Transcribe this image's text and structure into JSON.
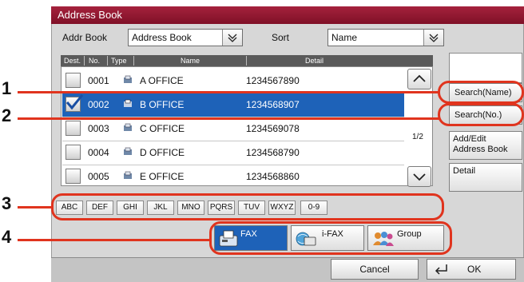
{
  "window": {
    "title": "Address Book"
  },
  "top": {
    "addr_book_label": "Addr Book",
    "addr_book_value": "Address Book",
    "sort_label": "Sort",
    "sort_value": "Name"
  },
  "table": {
    "headers": [
      "Dest.",
      "No.",
      "Type",
      "Name",
      "Detail"
    ],
    "rows": [
      {
        "checked": false,
        "no": "0001",
        "type_icon": "fax-icon",
        "name": "A OFFICE",
        "detail": "1234567890"
      },
      {
        "checked": true,
        "no": "0002",
        "type_icon": "fax-icon",
        "name": "B OFFICE",
        "detail": "1234568907"
      },
      {
        "checked": false,
        "no": "0003",
        "type_icon": "fax-icon",
        "name": "C OFFICE",
        "detail": "1234569078"
      },
      {
        "checked": false,
        "no": "0004",
        "type_icon": "fax-icon",
        "name": "D OFFICE",
        "detail": "1234568790"
      },
      {
        "checked": false,
        "no": "0005",
        "type_icon": "fax-icon",
        "name": "E OFFICE",
        "detail": "1234568860"
      }
    ]
  },
  "paging": {
    "page": "1/2"
  },
  "side": {
    "search_name": "Search(Name)",
    "search_no": "Search(No.)",
    "add_edit": "Add/Edit Address Book",
    "detail": "Detail"
  },
  "index_buttons": [
    "ABC",
    "DEF",
    "GHI",
    "JKL",
    "MNO",
    "PQRS",
    "TUV",
    "WXYZ",
    "0-9"
  ],
  "type_buttons": {
    "fax": "FAX",
    "ifax": "i-FAX",
    "group": "Group",
    "selected": "FAX"
  },
  "bottom": {
    "cancel": "Cancel",
    "ok": "OK"
  },
  "callouts": [
    "1",
    "2",
    "3",
    "4"
  ],
  "colors": {
    "title_bar": "#8f1730",
    "selection": "#1e62b8",
    "callout": "#e0341e"
  }
}
